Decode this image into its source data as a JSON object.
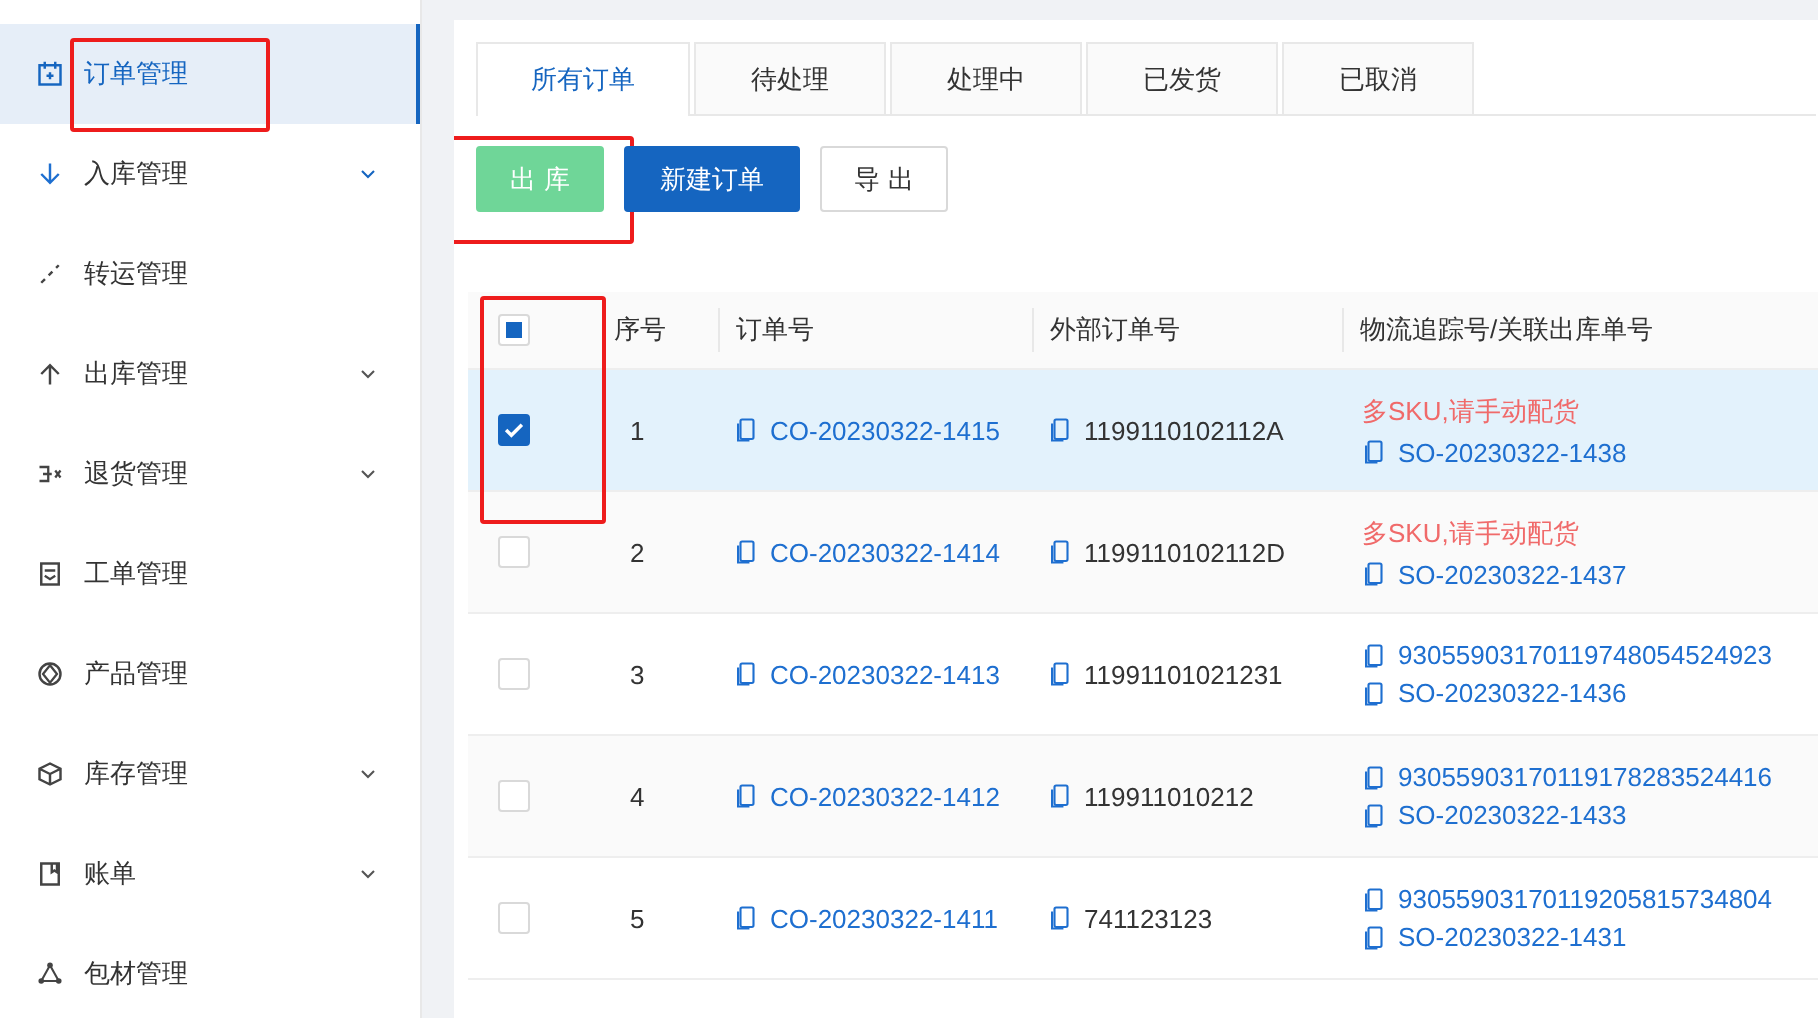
{
  "sidebar": {
    "items": [
      {
        "label": "订单管理",
        "selected": true,
        "expandable": false,
        "highlighted": true
      },
      {
        "label": "入库管理",
        "selected": false,
        "expandable": true,
        "highlighted": false
      },
      {
        "label": "转运管理",
        "selected": false,
        "expandable": false,
        "highlighted": false
      },
      {
        "label": "出库管理",
        "selected": false,
        "expandable": true,
        "highlighted": false
      },
      {
        "label": "退货管理",
        "selected": false,
        "expandable": true,
        "highlighted": false
      },
      {
        "label": "工单管理",
        "selected": false,
        "expandable": false,
        "highlighted": false
      },
      {
        "label": "产品管理",
        "selected": false,
        "expandable": false,
        "highlighted": false
      },
      {
        "label": "库存管理",
        "selected": false,
        "expandable": true,
        "highlighted": false
      },
      {
        "label": "账单",
        "selected": false,
        "expandable": true,
        "highlighted": false
      },
      {
        "label": "包材管理",
        "selected": false,
        "expandable": false,
        "highlighted": false
      }
    ]
  },
  "tabs": [
    {
      "label": "所有订单",
      "selected": true
    },
    {
      "label": "待处理",
      "selected": false
    },
    {
      "label": "处理中",
      "selected": false
    },
    {
      "label": "已发货",
      "selected": false
    },
    {
      "label": "已取消",
      "selected": false
    }
  ],
  "buttons": [
    {
      "label": "出 库",
      "kind": "success",
      "disabled": true,
      "highlighted": true
    },
    {
      "label": "新建订单",
      "kind": "primary",
      "disabled": false,
      "highlighted": false
    },
    {
      "label": "导 出",
      "kind": "default",
      "disabled": false,
      "highlighted": false
    }
  ],
  "table": {
    "select_all": {
      "indeterminate": true,
      "highlighted": true
    },
    "columns": [
      "序号",
      "订单号",
      "外部订单号",
      "物流追踪号/关联出库单号"
    ],
    "rows": [
      {
        "checked": true,
        "index": "1",
        "order_no": "CO-20230322-1415",
        "external_no": "1199110102112A",
        "tracking": [
          {
            "kind": "warning",
            "text": "多SKU,请手动配货"
          },
          {
            "kind": "link",
            "text": "SO-20230322-1438"
          }
        ]
      },
      {
        "checked": false,
        "index": "2",
        "order_no": "CO-20230322-1414",
        "external_no": "1199110102112D",
        "tracking": [
          {
            "kind": "warning",
            "text": "多SKU,请手动配货"
          },
          {
            "kind": "link",
            "text": "SO-20230322-1437"
          }
        ]
      },
      {
        "checked": false,
        "index": "3",
        "order_no": "CO-20230322-1413",
        "external_no": "11991101021231",
        "tracking": [
          {
            "kind": "link",
            "text": "93055903170119748054524923"
          },
          {
            "kind": "link",
            "text": "SO-20230322-1436"
          }
        ]
      },
      {
        "checked": false,
        "index": "4",
        "order_no": "CO-20230322-1412",
        "external_no": "119911010212",
        "tracking": [
          {
            "kind": "link",
            "text": "93055903170119178283524416"
          },
          {
            "kind": "link",
            "text": "SO-20230322-1433"
          }
        ]
      },
      {
        "checked": false,
        "index": "5",
        "order_no": "CO-20230322-1411",
        "external_no": "741123123",
        "tracking": [
          {
            "kind": "link",
            "text": "93055903170119205815734804"
          },
          {
            "kind": "link",
            "text": "SO-20230322-1431"
          }
        ]
      }
    ]
  }
}
